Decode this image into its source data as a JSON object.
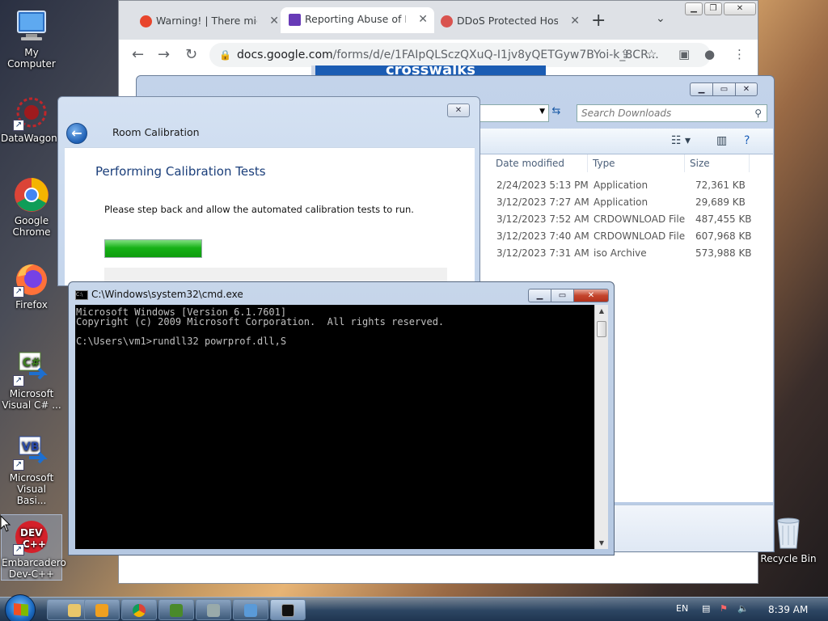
{
  "desktop": {
    "icons": [
      {
        "label": "My Computer"
      },
      {
        "label": "DataWagon..."
      },
      {
        "label": "Google Chrome"
      },
      {
        "label": "Firefox"
      },
      {
        "label": "Microsoft Visual C# ..."
      },
      {
        "label": "Microsoft Visual Basi..."
      },
      {
        "label": "Embarcadero Dev-C++"
      },
      {
        "label": "Recycle Bin"
      }
    ]
  },
  "chrome": {
    "tabs": [
      {
        "title": "Warning! | There might",
        "favicon_color": "#e8452c"
      },
      {
        "title": "Reporting Abuse of Bit",
        "favicon_color": "#673ab7"
      },
      {
        "title": "DDoS Protected Hostin",
        "favicon_color": "#d9534f"
      }
    ],
    "new_tab": "+",
    "url_host": "docs.google.com",
    "url_path": "/forms/d/e/1FAIpQLSczQXuQ-I1jv8yQETGyw7BYoi-k_8CR...",
    "page_banner": "crosswalks"
  },
  "explorer": {
    "search_placeholder": "Search Downloads",
    "columns": [
      "Date modified",
      "Type",
      "Size"
    ],
    "rows": [
      {
        "date": "2/24/2023 5:13 PM",
        "type": "Application",
        "size": "72,361 KB"
      },
      {
        "date": "3/12/2023 7:27 AM",
        "type": "Application",
        "size": "29,689 KB"
      },
      {
        "date": "3/12/2023 7:52 AM",
        "type": "CRDOWNLOAD File",
        "size": "487,455 KB"
      },
      {
        "date": "3/12/2023 7:40 AM",
        "type": "CRDOWNLOAD File",
        "size": "607,968 KB"
      },
      {
        "date": "3/12/2023 7:31 AM",
        "type": "iso Archive",
        "size": "573,988 KB"
      }
    ]
  },
  "wizard": {
    "window_title": "Room Calibration",
    "heading": "Performing Calibration Tests",
    "instruction": "Please step back and allow the automated calibration tests to run.",
    "progress_fraction": 0.28
  },
  "cmd": {
    "title": "C:\\Windows\\system32\\cmd.exe",
    "lines": [
      "Microsoft Windows [Version 6.1.7601]",
      "Copyright (c) 2009 Microsoft Corporation.  All rights reserved.",
      "",
      "C:\\Users\\vm1>rundll32 powrprof.dll,S"
    ]
  },
  "taskbar": {
    "language": "EN",
    "clock": "8:39 AM"
  }
}
